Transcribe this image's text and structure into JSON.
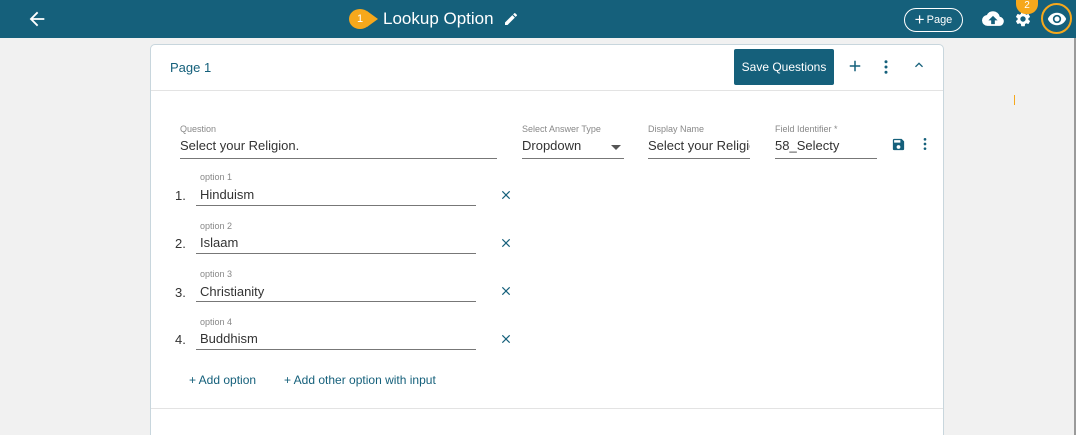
{
  "header": {
    "title": "Lookup Option",
    "step1_badge": "1",
    "step2_badge": "2",
    "page_button_label": "Page",
    "page_button_plus": "+",
    "icons": [
      "back-arrow-icon",
      "edit-pencil-icon",
      "cloud-upload-icon",
      "gear-icon",
      "eye-icon"
    ]
  },
  "card": {
    "page_label": "Page 1",
    "save_button_label": "Save Questions",
    "question": {
      "label": "Question",
      "value": "Select your Religion."
    },
    "answer_type": {
      "label": "Select Answer Type",
      "value": "Dropdown"
    },
    "display_name": {
      "label": "Display Name",
      "value": "Select your Religio"
    },
    "field_identifier": {
      "label": "Field Identifier *",
      "value": "58_Selecty"
    },
    "options": [
      {
        "num": "1.",
        "label": "option 1",
        "value": "Hinduism"
      },
      {
        "num": "2.",
        "label": "option 2",
        "value": "Islaam"
      },
      {
        "num": "3.",
        "label": "option 3",
        "value": "Christianity"
      },
      {
        "num": "4.",
        "label": "option 4",
        "value": "Buddhism"
      }
    ],
    "add_option_label": "+ Add option",
    "add_other_option_label": "+ Add other option with input"
  },
  "colors": {
    "primary": "#15607b",
    "accent": "#f6a81c",
    "background": "#f1f1f1"
  }
}
